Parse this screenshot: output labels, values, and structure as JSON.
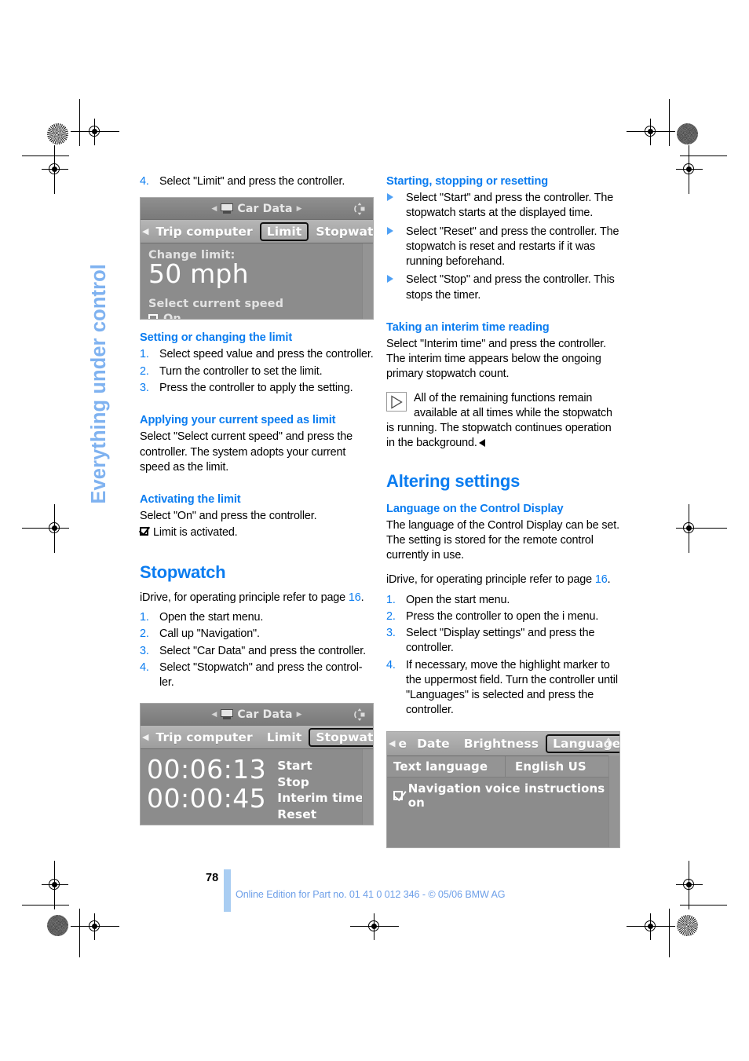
{
  "running_head": "Everything under control",
  "page_number": "78",
  "footer": "Online Edition for Part no. 01 41 0 012 346 - © 05/06 BMW AG",
  "left_column": {
    "step4": {
      "num": "4.",
      "text": "Select \"Limit\" and press the controller."
    },
    "limit_screen": {
      "title": "Car Data",
      "tabs": [
        "Trip computer",
        "Limit",
        "Stopwatch"
      ],
      "selected_tab": "Limit",
      "label": "Change limit:",
      "value": "50 mph",
      "option": "Select current speed",
      "checkbox_label": "On",
      "checkbox_checked": false
    },
    "setting_heading": "Setting or changing the limit",
    "setting_steps": [
      {
        "num": "1.",
        "text": "Select speed value and press the controller."
      },
      {
        "num": "2.",
        "text": "Turn the controller to set the limit."
      },
      {
        "num": "3.",
        "text": "Press the controller to apply the setting."
      }
    ],
    "applying_heading": "Applying your current speed as limit",
    "applying_text": "Select \"Select current speed\" and press the controller. The system adopts your current speed as the limit.",
    "activating_heading": "Activating the limit",
    "activating_text": "Select \"On\" and press the controller.",
    "activating_result": "Limit is activated.",
    "stopwatch_heading": "Stopwatch",
    "stopwatch_intro_pre": "iDrive, for operating principle refer to page ",
    "stopwatch_intro_ref": "16",
    "stopwatch_intro_post": ".",
    "stopwatch_steps": [
      {
        "num": "1.",
        "text": "Open the start menu."
      },
      {
        "num": "2.",
        "text": "Call up \"Navigation\"."
      },
      {
        "num": "3.",
        "text": "Select \"Car Data\" and press the controller."
      },
      {
        "num": "4.",
        "text": "Select \"Stopwatch\" and press the control-ler."
      }
    ],
    "stopwatch_screen": {
      "title": "Car Data",
      "tabs": [
        "Trip computer",
        "Limit",
        "Stopwatch"
      ],
      "selected_tab": "Stopwatch",
      "primary_time": "00:06:13",
      "interim_time": "00:00:45",
      "menu": [
        "Start",
        "Stop",
        "Interim time",
        "Reset"
      ]
    }
  },
  "right_column": {
    "starting_heading": "Starting, stopping or resetting",
    "starting_bullets": [
      "Select \"Start\" and press the controller. The stopwatch starts at the displayed time.",
      "Select \"Reset\" and press the controller. The stopwatch is reset and restarts if it was running beforehand.",
      "Select \"Stop\" and press the controller. This stops the timer."
    ],
    "interim_heading": "Taking an interim time reading",
    "interim_text": "Select \"Interim time\" and press the controller. The interim time appears below the ongoing primary stopwatch count.",
    "note_text": "All of the remaining functions remain available at all times while the stopwatch is running. The stopwatch continues operation in the background.",
    "altering_heading": "Altering settings",
    "language_heading": "Language on the Control Display",
    "language_text": "The language of the Control Display can be set. The setting is stored for the remote control currently in use.",
    "language_intro_pre": "iDrive, for operating principle refer to page ",
    "language_intro_ref": "16",
    "language_intro_post": ".",
    "language_steps": [
      {
        "num": "1.",
        "text": "Open the start menu."
      },
      {
        "num": "2.",
        "text": "Press the controller to open the i menu."
      },
      {
        "num": "3.",
        "text": "Select \"Display settings\" and press the controller."
      },
      {
        "num": "4.",
        "text": "If necessary, move the highlight marker to the uppermost field. Turn the controller until \"Languages\" is selected and press the controller."
      }
    ],
    "language_screen": {
      "tabs": [
        "e",
        "Date",
        "Brightness",
        "Languages"
      ],
      "selected_tab": "Languages",
      "row_key": "Text language",
      "row_value": "English US",
      "checkbox_label": "Navigation voice instructions on",
      "checkbox_checked": true
    }
  },
  "colors": {
    "accent_blue": "#0a7cf0",
    "tab_blue": "#7fb2f0",
    "footer_blue": "#6d9fe8",
    "page_bar": "#a9cdf2",
    "screen_gray": "#8c8c8c"
  }
}
